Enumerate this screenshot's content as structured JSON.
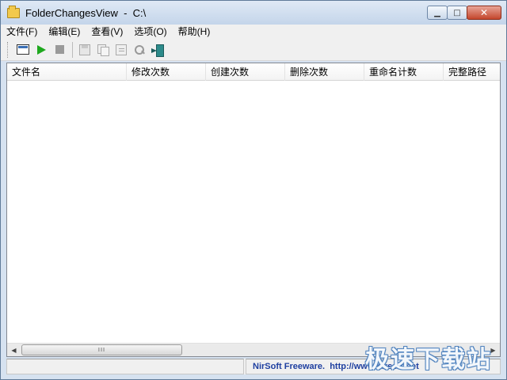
{
  "window": {
    "app_name": "FolderChangesView",
    "separator": "-",
    "path": "C:\\",
    "minimize_glyph": "▁",
    "maximize_glyph": "□",
    "close_glyph": "✕"
  },
  "menu": {
    "items": [
      {
        "label": "文件(F)"
      },
      {
        "label": "编辑(E)"
      },
      {
        "label": "查看(V)"
      },
      {
        "label": "选项(O)"
      },
      {
        "label": "帮助(H)"
      }
    ]
  },
  "toolbar": {
    "icons": [
      "html-report-icon",
      "start-icon",
      "stop-icon",
      "save-icon",
      "copy-icon",
      "properties-icon",
      "find-icon",
      "exit-icon"
    ]
  },
  "table": {
    "columns": [
      {
        "label": "文件名"
      },
      {
        "label": "修改次数"
      },
      {
        "label": "创建次数"
      },
      {
        "label": "删除次数"
      },
      {
        "label": "重命名计数"
      },
      {
        "label": "完整路径"
      }
    ],
    "rows": []
  },
  "scrollbar": {
    "left_glyph": "◀",
    "right_glyph": "▶",
    "thumb_grip": "III"
  },
  "status": {
    "link_text": "NirSoft Freeware.  http://www.nirsoft.net"
  },
  "watermark": {
    "text": "极速下载站"
  }
}
